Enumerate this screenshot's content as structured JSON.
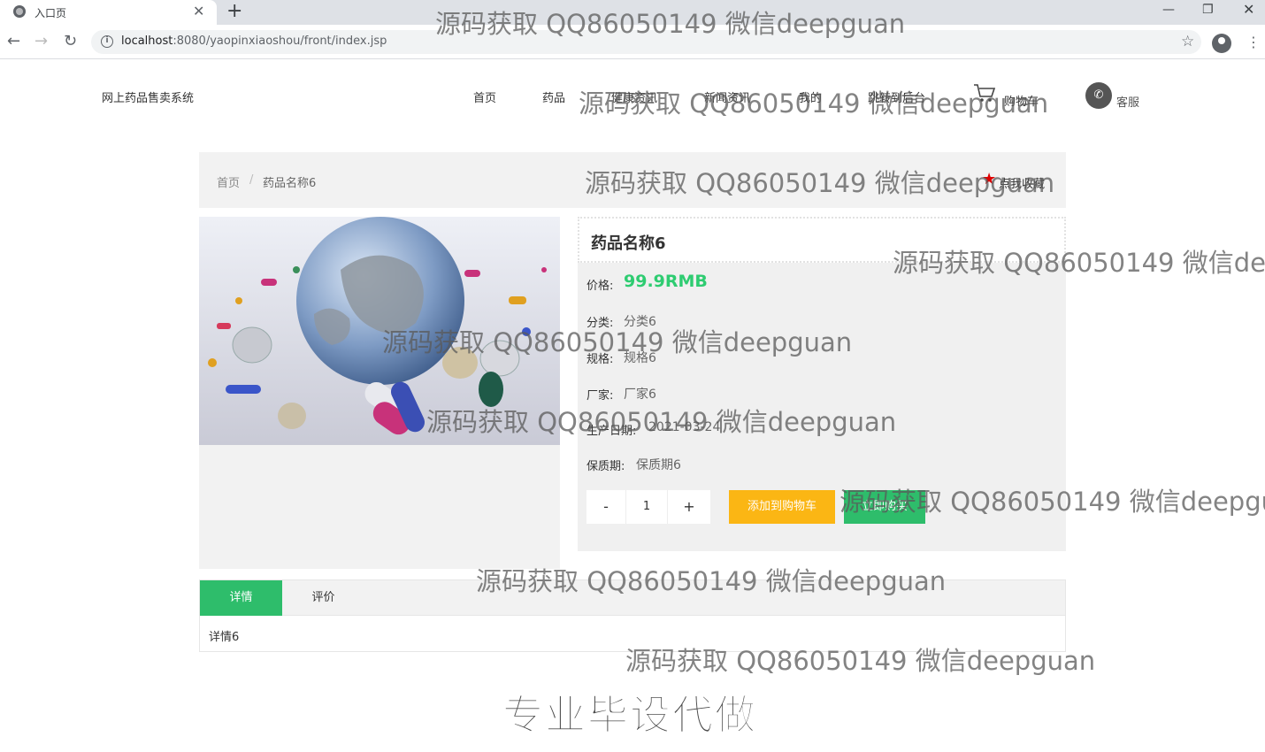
{
  "browser": {
    "tab_title": "入口页",
    "url_host": "localhost",
    "url_rest": ":8080/yaopinxiaoshou/front/index.jsp"
  },
  "header": {
    "site_title": "网上药品售卖系统",
    "nav": [
      "首页",
      "药品",
      "健康资讯",
      "新闻资讯",
      "我的",
      "跳转到后台"
    ],
    "cart_label": "购物车",
    "service_label": "客服"
  },
  "breadcrumb": {
    "home": "首页",
    "separator": "/",
    "current": "药品名称6",
    "favorite_label": "点我收藏"
  },
  "product": {
    "name": "药品名称6",
    "price_label": "价格:",
    "price": "99.9RMB",
    "fields": [
      {
        "label": "分类:",
        "value": "分类6"
      },
      {
        "label": "规格:",
        "value": "规格6"
      },
      {
        "label": "厂家:",
        "value": "厂家6"
      },
      {
        "label": "生产日期:",
        "value": "2021-03-24"
      },
      {
        "label": "保质期:",
        "value": "保质期6"
      }
    ],
    "quantity": "1",
    "minus": "-",
    "plus": "+",
    "add_to_cart": "添加到购物车",
    "buy_now": "立即购买"
  },
  "tabs": {
    "detail": "详情",
    "review": "评价",
    "content": "详情6"
  },
  "overlay": {
    "watermark": "源码获取 QQ86050149 微信deepguan",
    "promo": "专业毕设代做"
  },
  "colors": {
    "accent_green": "#2ebd6b",
    "price_green": "#2ecc71",
    "cart_yellow": "#fbb614",
    "favorite_red": "#dd0000"
  }
}
